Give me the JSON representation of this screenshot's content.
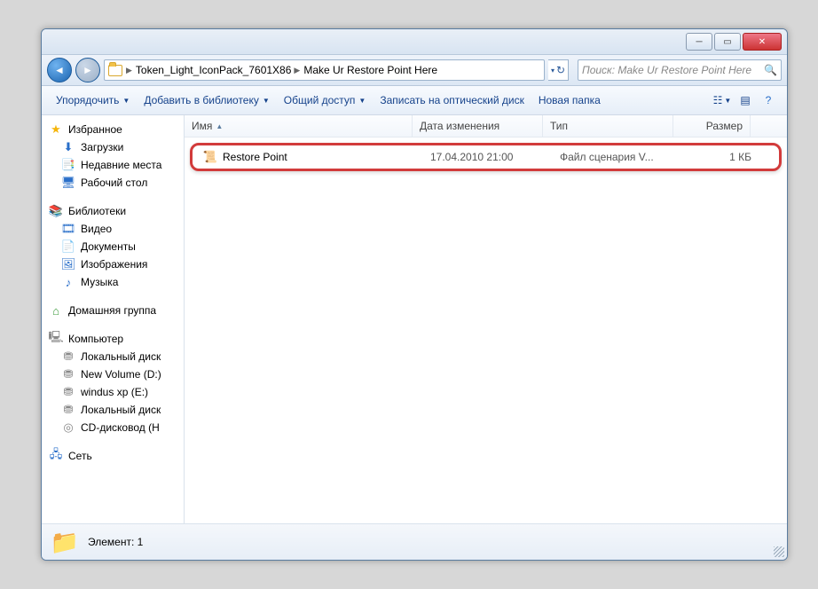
{
  "breadcrumbs": [
    "Token_Light_IconPack_7601X86",
    "Make Ur Restore Point Here"
  ],
  "search_placeholder": "Поиск: Make Ur Restore Point Here",
  "toolbar": {
    "organize": "Упорядочить",
    "add_library": "Добавить в библиотеку",
    "share": "Общий доступ",
    "burn": "Записать на оптический диск",
    "new_folder": "Новая папка"
  },
  "sidebar": {
    "favorites": {
      "head": "Избранное",
      "items": [
        "Загрузки",
        "Недавние места",
        "Рабочий стол"
      ]
    },
    "libraries": {
      "head": "Библиотеки",
      "items": [
        "Видео",
        "Документы",
        "Изображения",
        "Музыка"
      ]
    },
    "homegroup": {
      "head": "Домашняя группа"
    },
    "computer": {
      "head": "Компьютер",
      "items": [
        "Локальный диск",
        "New Volume (D:)",
        "windus xp (E:)",
        "Локальный диск",
        "CD-дисковод (H"
      ]
    },
    "network": {
      "head": "Сеть"
    }
  },
  "columns": {
    "name": "Имя",
    "date": "Дата изменения",
    "type": "Тип",
    "size": "Размер"
  },
  "files": [
    {
      "name": "Restore Point",
      "date": "17.04.2010 21:00",
      "type": "Файл сценария V...",
      "size": "1 КБ"
    }
  ],
  "status": {
    "text": "Элемент: 1"
  }
}
